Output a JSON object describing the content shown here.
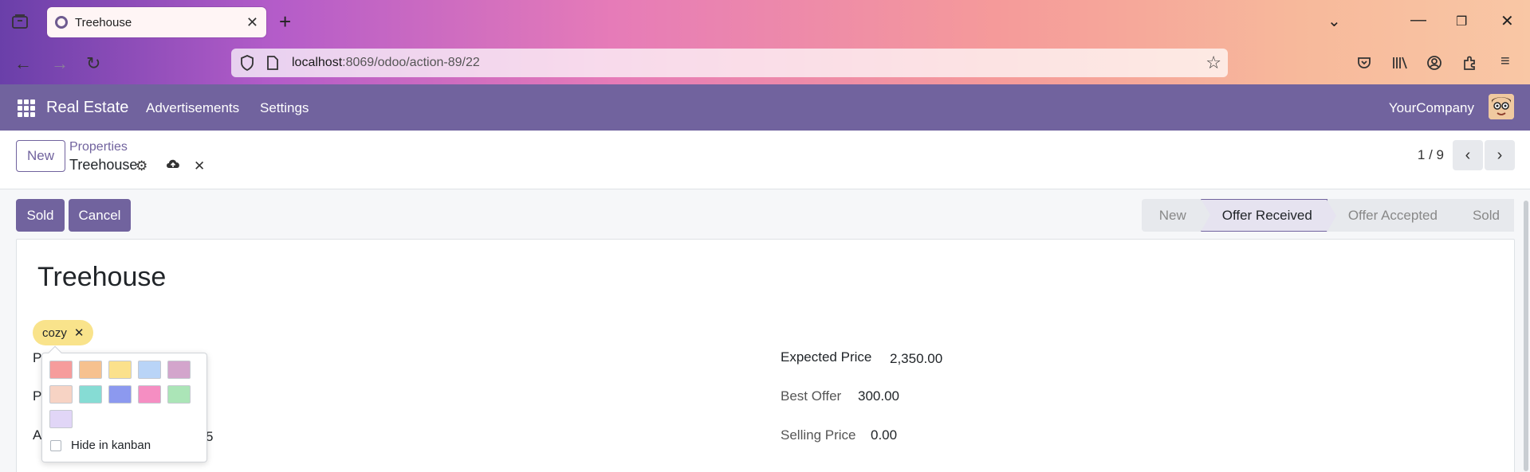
{
  "browser": {
    "tab_title": "Treehouse",
    "url_host": "localhost",
    "url_rest": ":8069/odoo/action-89/22"
  },
  "navbar": {
    "app_name": "Real Estate",
    "menu": [
      "Advertisements",
      "Settings"
    ],
    "company": "YourCompany"
  },
  "control_panel": {
    "new_label": "New",
    "breadcrumb_parent": "Properties",
    "breadcrumb_current": "Treehouse",
    "pager": "1 / 9"
  },
  "status": {
    "buttons": [
      "Sold",
      "Cancel"
    ],
    "stages": [
      "New",
      "Offer Received",
      "Offer Accepted",
      "Sold"
    ],
    "active_stage": "Offer Received"
  },
  "form": {
    "title": "Treehouse",
    "tag": "cozy",
    "left_partial": {
      "label_1": "P",
      "label_2": "P",
      "label_3": "A",
      "value_3": "5"
    },
    "expected_price_label": "Expected Price",
    "expected_price": "2,350.00",
    "best_offer_label": "Best Offer",
    "best_offer": "300.00",
    "selling_price_label": "Selling Price",
    "selling_price": "0.00"
  },
  "color_picker": {
    "colors": [
      "#f69c9c",
      "#f6c18f",
      "#fbe18c",
      "#b9d4f7",
      "#d3a5cc",
      "#f7d3c4",
      "#86dcd4",
      "#8c99ef",
      "#f58ec2",
      "#abe5b7",
      "#e1d6f7"
    ],
    "hide_in_kanban_label": "Hide in kanban"
  },
  "colors": {
    "brand": "#71639e",
    "tag_yellow": "#f9e38b"
  }
}
